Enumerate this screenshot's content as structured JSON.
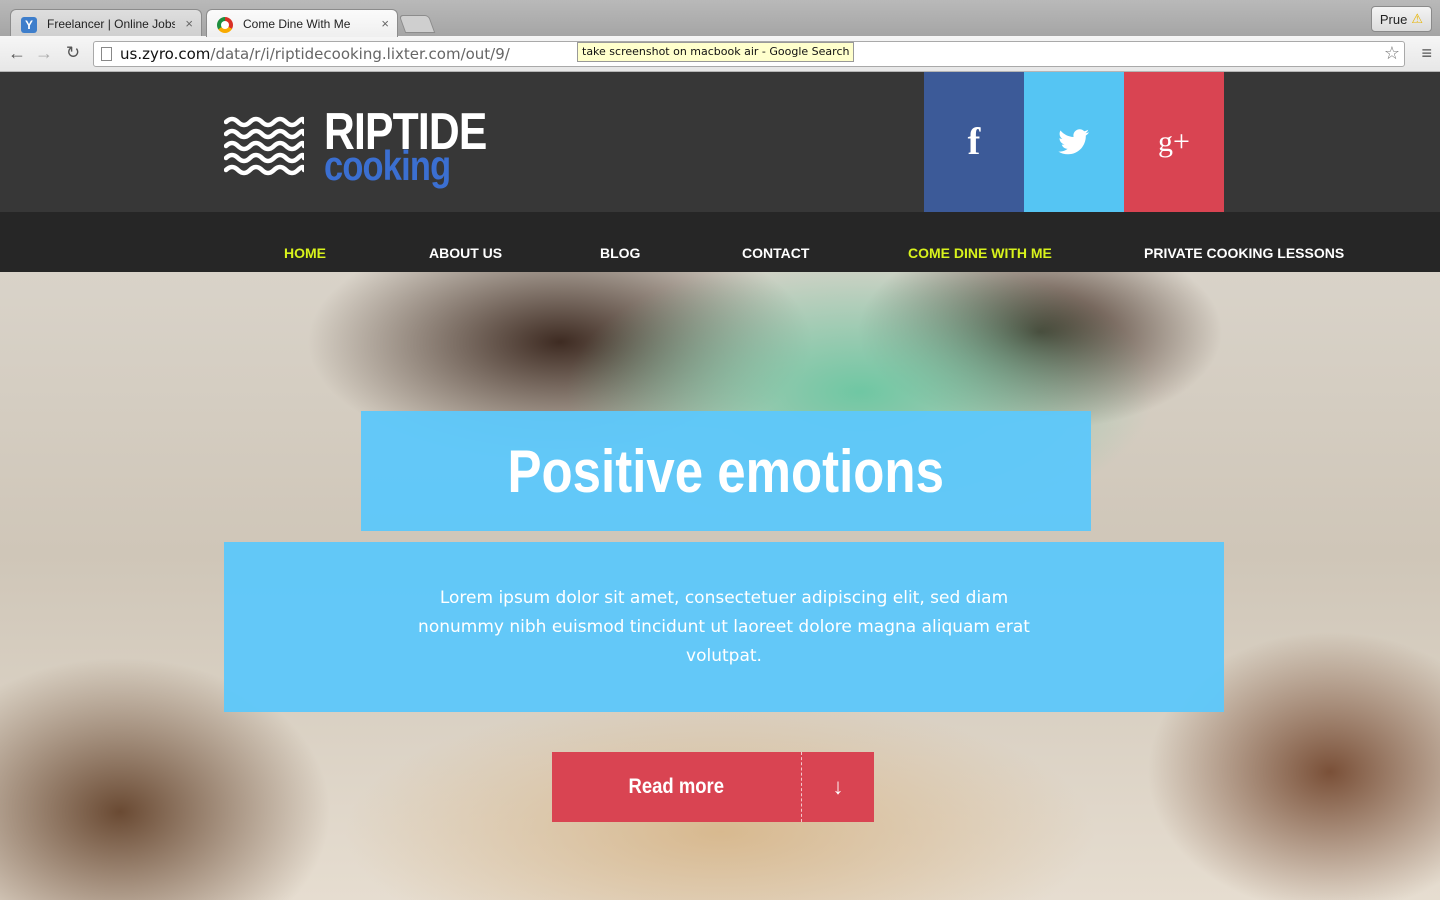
{
  "browser": {
    "tabs": [
      {
        "title": "Freelancer | Online Jobs | F",
        "close": "×"
      },
      {
        "title": "Come Dine With Me",
        "close": "×"
      }
    ],
    "profile_name": "Prue",
    "profile_icon": "warning-icon",
    "url_domain": "us.zyro.com",
    "url_path": "/data/r/i/riptidecooking.lixter.com/out/9/",
    "tooltip": "take screenshot on macbook air - Google Search"
  },
  "site": {
    "logo_word1": "RIPTIDE",
    "logo_word2": "cooking",
    "social": {
      "facebook": "f",
      "twitter": "twitter-bird-icon",
      "googleplus": "g+"
    },
    "nav": [
      {
        "label": "HOME",
        "active": true
      },
      {
        "label": "ABOUT US",
        "active": false
      },
      {
        "label": "BLOG",
        "active": false
      },
      {
        "label": "CONTACT",
        "active": false
      },
      {
        "label": "COME DINE WITH ME",
        "active": true
      },
      {
        "label": "PRIVATE COOKING LESSONS",
        "active": false
      }
    ],
    "hero": {
      "title": "Positive emotions",
      "text": "Lorem ipsum dolor sit amet, consectetuer adipiscing elit, sed diam nonummy nibh euismod tincidunt ut laoreet dolore magna aliquam erat volutpat.",
      "cta_label": "Read more",
      "cta_arrow": "↓"
    },
    "colors": {
      "header_bg": "#373737",
      "nav_bg": "#262626",
      "nav_active": "#d8f21c",
      "logo_blue": "#3b6fd1",
      "facebook": "#3c5a98",
      "twitter": "#55c5f3",
      "googleplus": "#d94452",
      "hero_box": "#5ec8fa",
      "cta": "#d94452"
    }
  }
}
